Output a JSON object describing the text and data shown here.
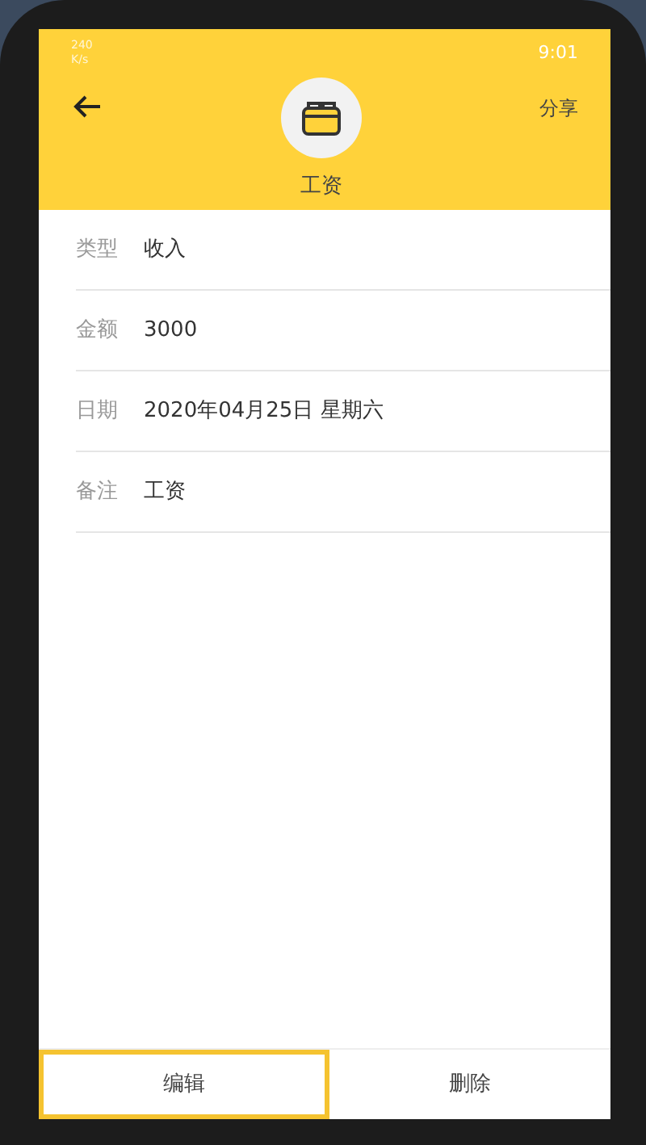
{
  "status_bar": {
    "net_speed": "240 K/s",
    "time": "9:01"
  },
  "header": {
    "title": "工资",
    "share": "分享"
  },
  "fields": [
    {
      "label": "类型",
      "value": "收入"
    },
    {
      "label": "金额",
      "value": "3000"
    },
    {
      "label": "日期",
      "value": "2020年04月25日 星期六"
    },
    {
      "label": "备注",
      "value": "工资"
    }
  ],
  "actions": [
    {
      "label": "编辑",
      "highlighted": true
    },
    {
      "label": "删除",
      "highlighted": false
    }
  ]
}
